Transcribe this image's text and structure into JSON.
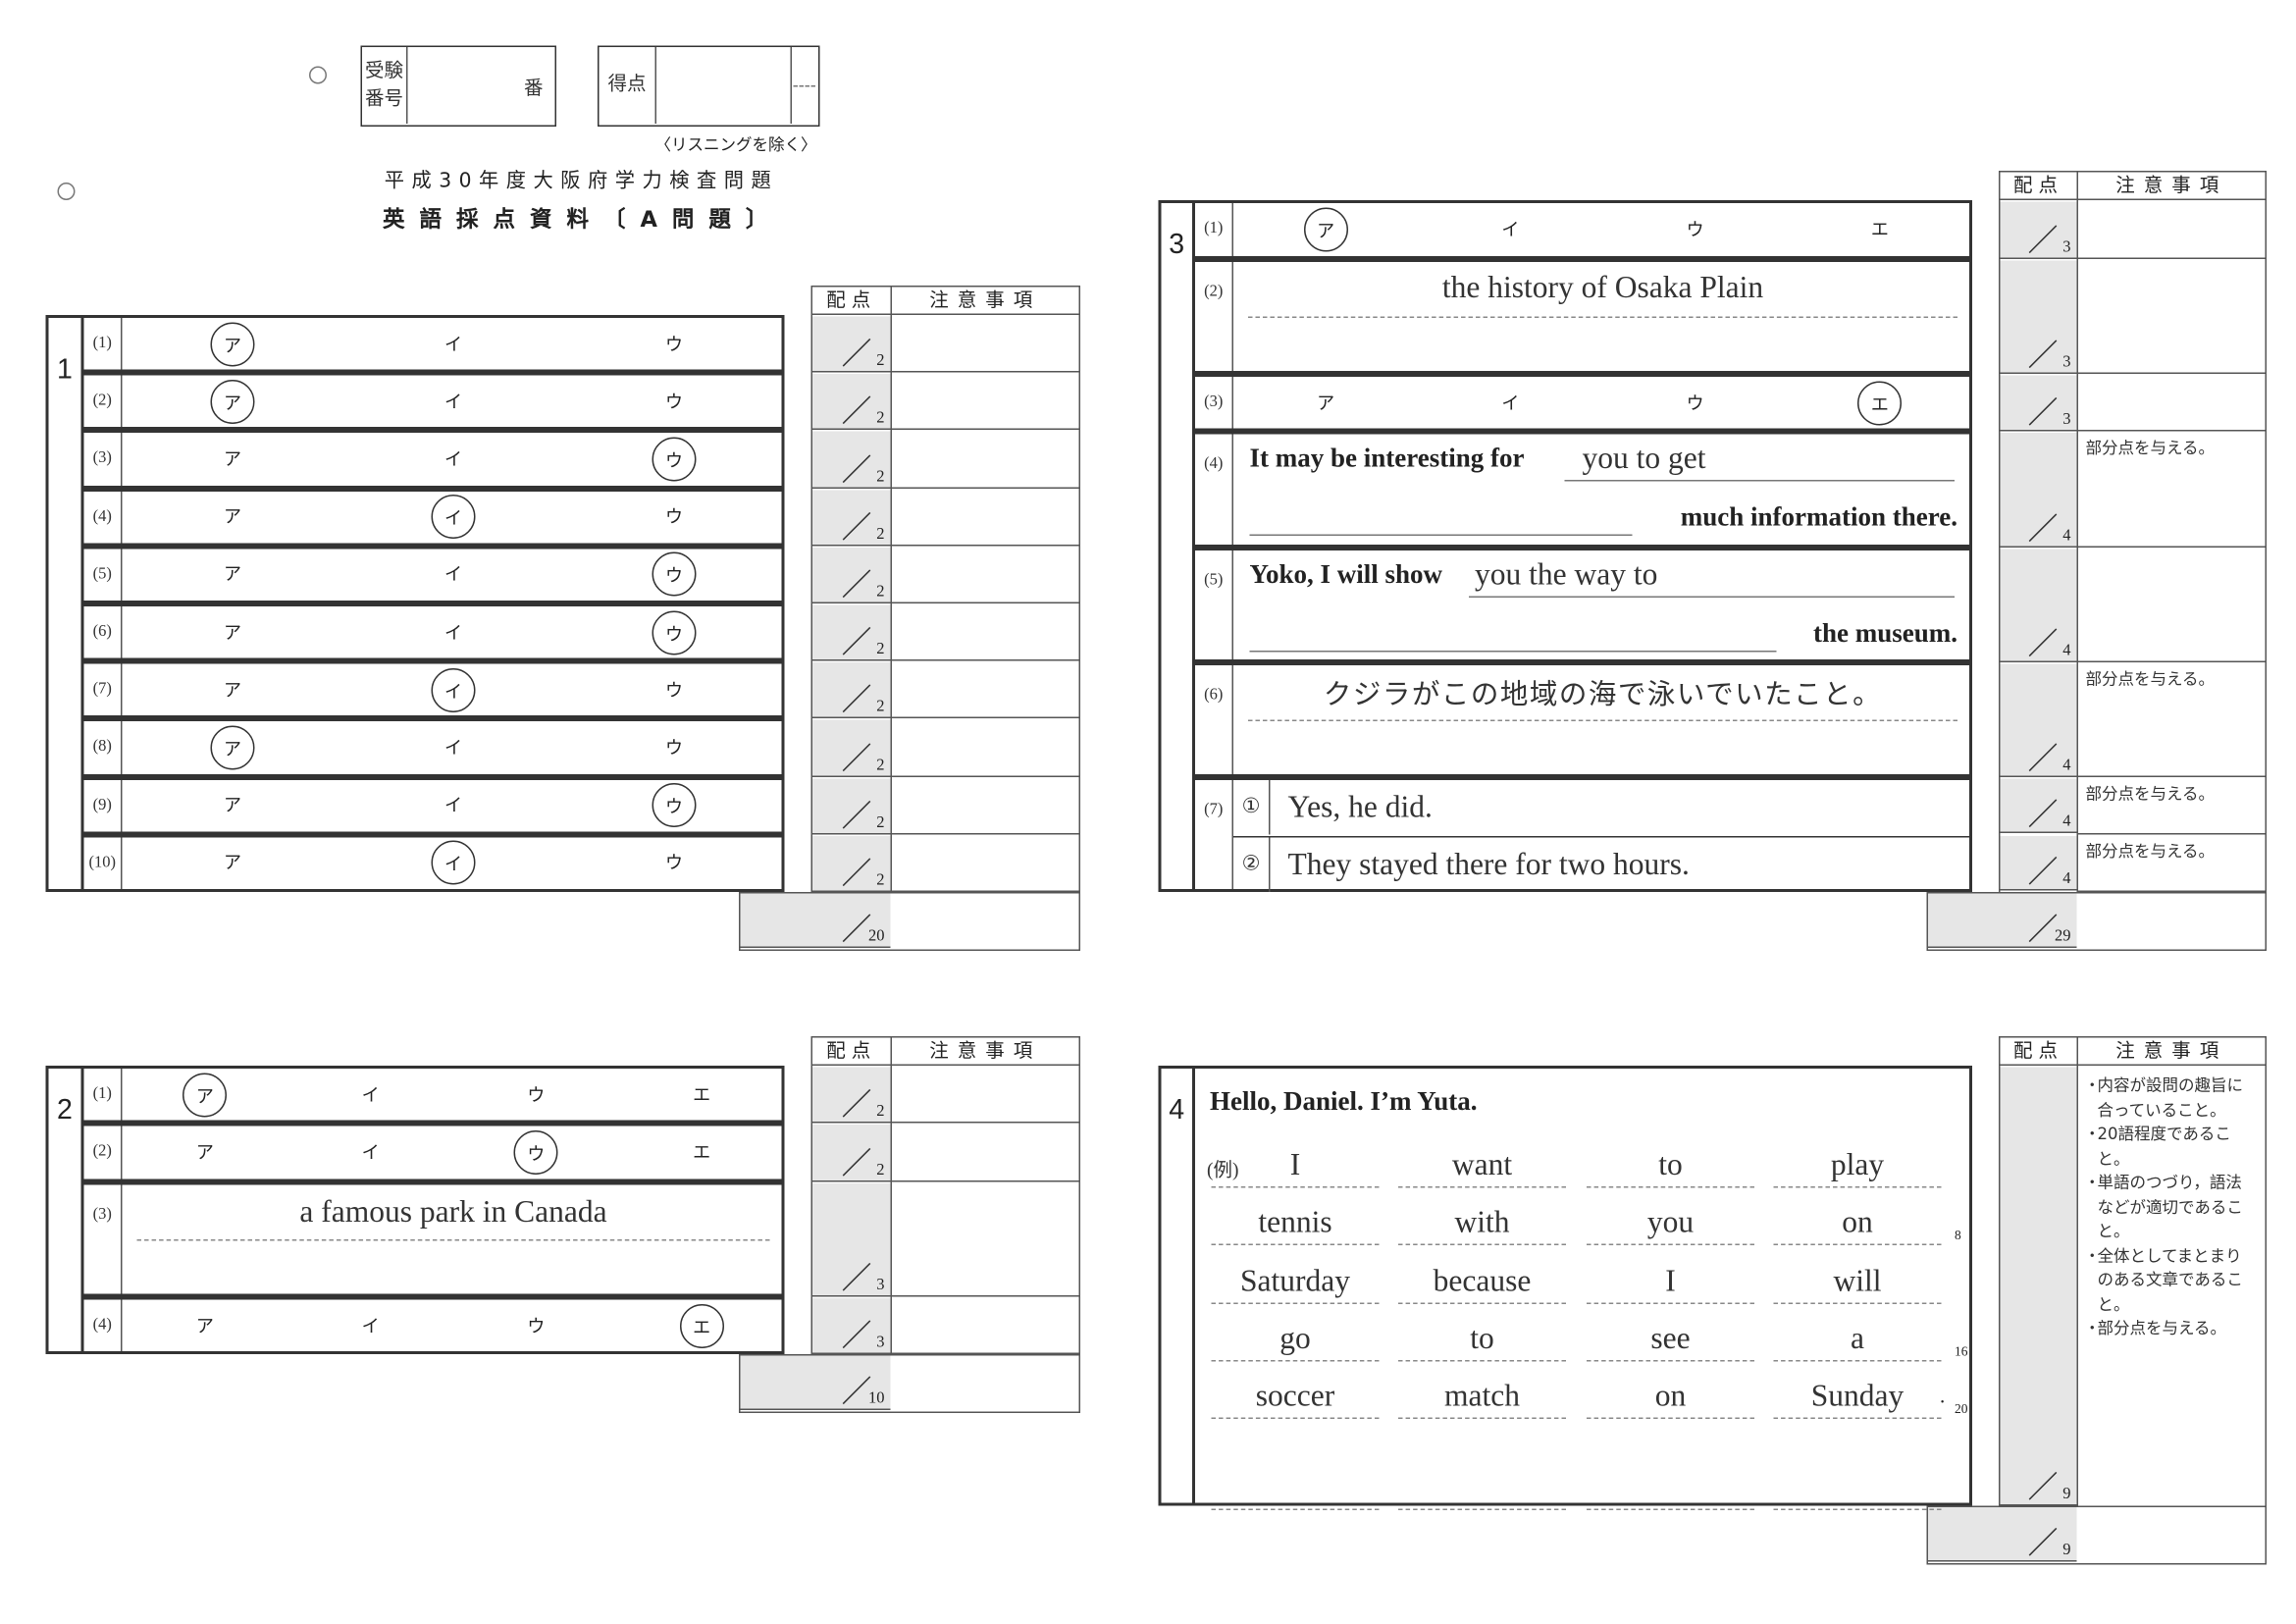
{
  "header": {
    "exam_number_label_1": "受験",
    "exam_number_label_2": "番号",
    "exam_number_suffix": "番",
    "score_label": "得点",
    "listening_note": "〈リスニングを除く〉",
    "title": "平成30年度大阪府学力検査問題",
    "subtitle": "英語採点資料〔A問題〕"
  },
  "columns": {
    "points": "配点",
    "notes": "注意事項"
  },
  "sections": [
    {
      "number": "1",
      "total": "20",
      "rows": [
        {
          "label": "(1)",
          "type": "choice",
          "choices": [
            "ア",
            "イ",
            "ウ"
          ],
          "answer": 0,
          "points": "2"
        },
        {
          "label": "(2)",
          "type": "choice",
          "choices": [
            "ア",
            "イ",
            "ウ"
          ],
          "answer": 0,
          "points": "2"
        },
        {
          "label": "(3)",
          "type": "choice",
          "choices": [
            "ア",
            "イ",
            "ウ"
          ],
          "answer": 2,
          "points": "2"
        },
        {
          "label": "(4)",
          "type": "choice",
          "choices": [
            "ア",
            "イ",
            "ウ"
          ],
          "answer": 1,
          "points": "2"
        },
        {
          "label": "(5)",
          "type": "choice",
          "choices": [
            "ア",
            "イ",
            "ウ"
          ],
          "answer": 2,
          "points": "2"
        },
        {
          "label": "(6)",
          "type": "choice",
          "choices": [
            "ア",
            "イ",
            "ウ"
          ],
          "answer": 2,
          "points": "2"
        },
        {
          "label": "(7)",
          "type": "choice",
          "choices": [
            "ア",
            "イ",
            "ウ"
          ],
          "answer": 1,
          "points": "2"
        },
        {
          "label": "(8)",
          "type": "choice",
          "choices": [
            "ア",
            "イ",
            "ウ"
          ],
          "answer": 0,
          "points": "2"
        },
        {
          "label": "(9)",
          "type": "choice",
          "choices": [
            "ア",
            "イ",
            "ウ"
          ],
          "answer": 2,
          "points": "2"
        },
        {
          "label": "(10)",
          "type": "choice",
          "choices": [
            "ア",
            "イ",
            "ウ"
          ],
          "answer": 1,
          "points": "2"
        }
      ]
    },
    {
      "number": "2",
      "total": "10",
      "rows": [
        {
          "label": "(1)",
          "type": "choice",
          "choices": [
            "ア",
            "イ",
            "ウ",
            "エ"
          ],
          "answer": 0,
          "points": "2"
        },
        {
          "label": "(2)",
          "type": "choice",
          "choices": [
            "ア",
            "イ",
            "ウ",
            "エ"
          ],
          "answer": 2,
          "points": "2"
        },
        {
          "label": "(3)",
          "type": "text",
          "answer": "a famous park in Canada",
          "points": "3"
        },
        {
          "label": "(4)",
          "type": "choice",
          "choices": [
            "ア",
            "イ",
            "ウ",
            "エ"
          ],
          "answer": 3,
          "points": "3"
        }
      ]
    },
    {
      "number": "3",
      "total": "29",
      "rows": [
        {
          "label": "(1)",
          "type": "choice",
          "choices": [
            "ア",
            "イ",
            "ウ",
            "エ"
          ],
          "answer": 0,
          "points": "3"
        },
        {
          "label": "(2)",
          "type": "text",
          "answer": "the history of Osaka Plain",
          "points": "3"
        },
        {
          "label": "(3)",
          "type": "choice",
          "choices": [
            "ア",
            "イ",
            "ウ",
            "エ"
          ],
          "answer": 3,
          "points": "3"
        },
        {
          "label": "(4)",
          "type": "sentence",
          "prefix": "It may be interesting for",
          "answer": "you to get",
          "suffix": "much information there.",
          "points": "4",
          "note": "部分点を与える。"
        },
        {
          "label": "(5)",
          "type": "sentence",
          "prefix": "Yoko, I will show",
          "answer": "you the way to",
          "suffix": "the museum.",
          "points": "4"
        },
        {
          "label": "(6)",
          "type": "text",
          "answer": "クジラがこの地域の海で泳いでいたこと。",
          "points": "4",
          "note": "部分点を与える。"
        },
        {
          "label": "(7)",
          "type": "parts",
          "parts": [
            {
              "mark": "①",
              "answer": "Yes, he did.",
              "points": "4",
              "note": "部分点を与える。"
            },
            {
              "mark": "②",
              "answer": "They stayed there for two hours.",
              "points": "4",
              "note": "部分点を与える。"
            }
          ]
        }
      ]
    },
    {
      "number": "4",
      "total": "9",
      "points": "9",
      "greeting": "Hello, Daniel.  I’m Yuta.",
      "example_label": "(例)",
      "words": [
        [
          "I",
          "want",
          "to",
          "play"
        ],
        [
          "tennis",
          "with",
          "you",
          "on"
        ],
        [
          "Saturday",
          "because",
          "I",
          "will"
        ],
        [
          "go",
          "to",
          "see",
          "a"
        ],
        [
          "soccer",
          "match",
          "on",
          "Sunday"
        ],
        [
          "",
          "",
          "",
          ""
        ]
      ],
      "word_counts": [
        "",
        "8",
        "",
        "16",
        "20",
        ""
      ],
      "final_punctuation": ".",
      "notes": [
        "内容が設問の趣旨に合っていること。",
        "20語程度であること。",
        "単語のつづり，語法などが適切であること。",
        "全体としてまとまりのある文章であること。",
        "部分点を与える。"
      ]
    }
  ]
}
